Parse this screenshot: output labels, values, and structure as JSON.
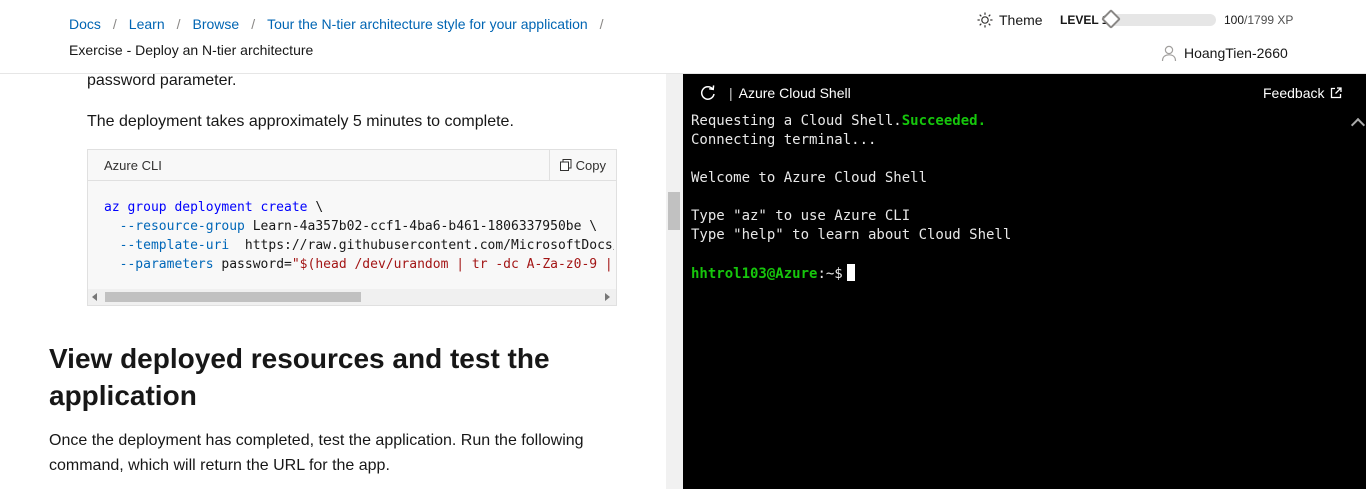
{
  "header": {
    "breadcrumbs": [
      "Docs",
      "Learn",
      "Browse",
      "Tour the N-tier architecture style for your application"
    ],
    "current_page": "Exercise - Deploy an N-tier architecture",
    "theme_label": "Theme",
    "level_label": "LEVEL 1",
    "xp_current": "100",
    "xp_total": "/1799 XP",
    "xp_progress_fraction": 0.056,
    "username": "HoangTien-2660"
  },
  "article": {
    "para_top": "password parameter.",
    "para_deploy": "The deployment takes approximately 5 minutes to complete.",
    "code_block": {
      "language": "Azure CLI",
      "copy_label": "Copy",
      "cmd_kw": "az group deployment create",
      "cmd_cont": " \\",
      "opt_rg": "--resource-group",
      "val_rg": " Learn-4a357b02-ccf1-4ba6-b461-1806337950be \\",
      "opt_tpl": "--template-uri",
      "val_tpl": "  https://raw.githubusercontent.com/MicrosoftDocs/m",
      "opt_params": "--parameters",
      "val_params_pre": " password=",
      "val_params_str": "\"$(head /dev/urandom | tr -dc A-Za-z0-9 | h"
    },
    "heading": "View deployed resources and test the application",
    "para_once": "Once the deployment has completed, test the application. Run the following command, which will return the URL for the app."
  },
  "shell": {
    "title": "Azure Cloud Shell",
    "feedback_label": "Feedback",
    "line1_pre": "Requesting a Cloud Shell.",
    "line1_ok": "Succeeded.",
    "line2": "Connecting terminal...",
    "line3": "Welcome to Azure Cloud Shell",
    "line4": "Type \"az\" to use Azure CLI",
    "line5": "Type \"help\" to learn about Cloud Shell",
    "prompt": "hhtrol103@Azure",
    "prompt_suffix": ":~$"
  },
  "colors": {
    "link": "#0065b3",
    "terminal_bg": "#000000",
    "terminal_ok": "#16c60c"
  }
}
